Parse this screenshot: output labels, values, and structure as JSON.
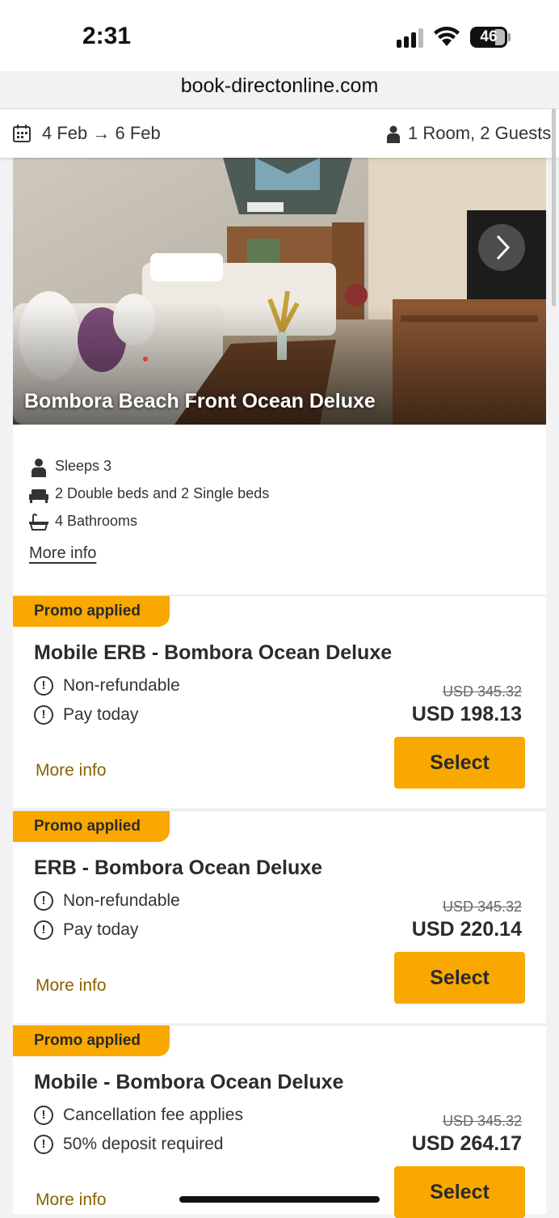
{
  "status_bar": {
    "time": "2:31",
    "battery": "46"
  },
  "browser": {
    "url": "book-directonline.com"
  },
  "booking_bar": {
    "dates": "4 Feb → 6 Feb",
    "guests": "1 Room, 2 Guests"
  },
  "room": {
    "name": "Bombora Beach Front Ocean Deluxe",
    "features": [
      "Sleeps 3",
      "2 Double beds and 2 Single beds",
      "4 Bathrooms"
    ],
    "more_info": "More info"
  },
  "rates": [
    {
      "promo": "Promo applied",
      "title": "Mobile ERB - Bombora Ocean Deluxe",
      "conditions": [
        "Non-refundable",
        "Pay today"
      ],
      "original_price": "USD 345.32",
      "price": "USD 198.13",
      "select": "Select",
      "more_info": "More info"
    },
    {
      "promo": "Promo applied",
      "title": "ERB - Bombora Ocean Deluxe",
      "conditions": [
        "Non-refundable",
        "Pay today"
      ],
      "original_price": "USD 345.32",
      "price": "USD 220.14",
      "select": "Select",
      "more_info": "More info"
    },
    {
      "promo": "Promo applied",
      "title": "Mobile - Bombora Ocean Deluxe",
      "conditions": [
        "Cancellation fee applies",
        "50% deposit required"
      ],
      "original_price": "USD 345.32",
      "price": "USD 264.17",
      "select": "Select",
      "more_info": "More info"
    }
  ],
  "colors": {
    "accent": "#f9a800",
    "link": "#8a6200"
  }
}
